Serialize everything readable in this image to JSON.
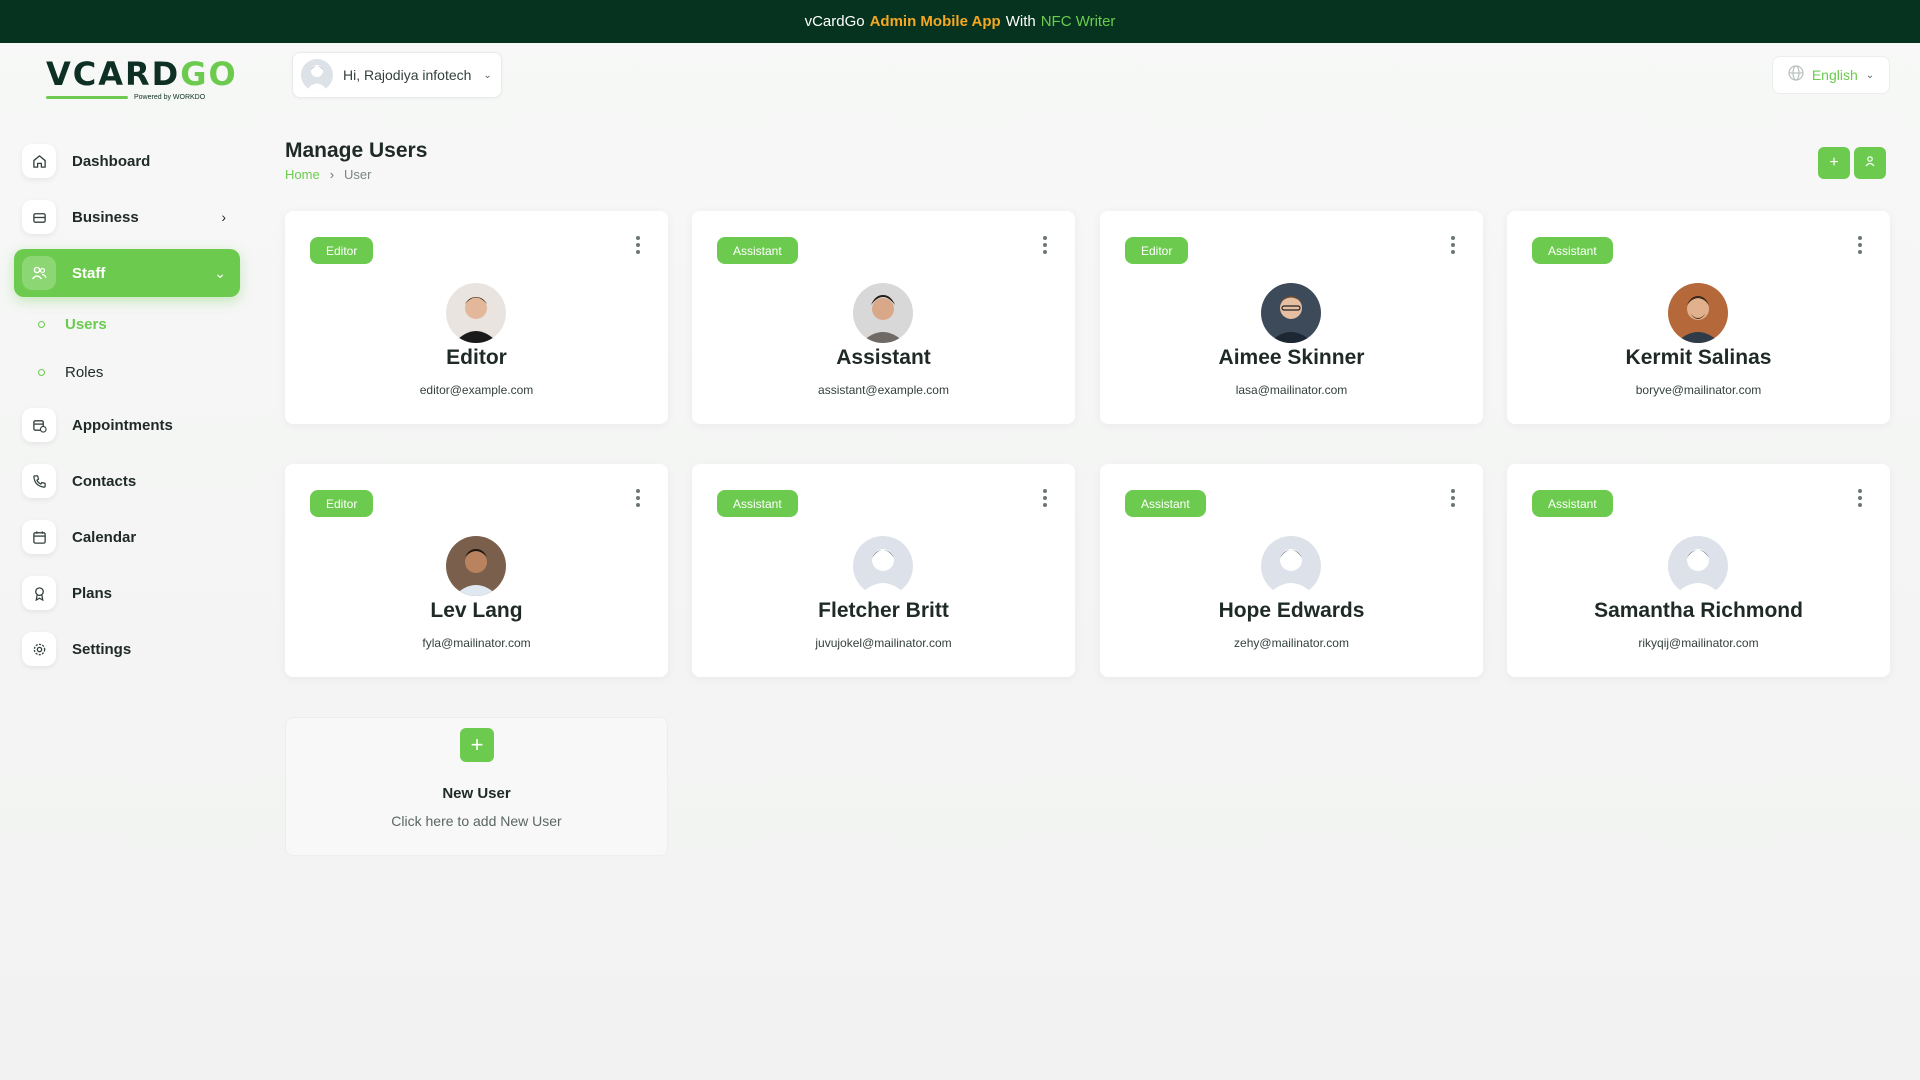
{
  "banner": {
    "part1": "vCardGo",
    "part2": "Admin Mobile App",
    "part3": "With",
    "part4": "NFC Writer"
  },
  "logo": {
    "main": "VCARD",
    "accent": "GO",
    "powered": "Powered by WORKDO"
  },
  "header": {
    "greeting": "Hi, Rajodiya infotech",
    "language": "English"
  },
  "sidebar": {
    "items": [
      {
        "label": "Dashboard",
        "icon": "home-icon"
      },
      {
        "label": "Business",
        "icon": "briefcase-icon"
      },
      {
        "label": "Staff",
        "icon": "users-icon"
      },
      {
        "label": "Appointments",
        "icon": "calendar-clock-icon"
      },
      {
        "label": "Contacts",
        "icon": "phone-icon"
      },
      {
        "label": "Calendar",
        "icon": "calendar-icon"
      },
      {
        "label": "Plans",
        "icon": "award-icon"
      },
      {
        "label": "Settings",
        "icon": "gear-icon"
      }
    ],
    "staff_sub": [
      {
        "label": "Users"
      },
      {
        "label": "Roles"
      }
    ]
  },
  "page": {
    "title": "Manage Users",
    "breadcrumb_home": "Home",
    "breadcrumb_current": "User"
  },
  "users": [
    {
      "role": "Editor",
      "name": "Editor",
      "email": "editor@example.com"
    },
    {
      "role": "Assistant",
      "name": "Assistant",
      "email": "assistant@example.com"
    },
    {
      "role": "Editor",
      "name": "Aimee Skinner",
      "email": "lasa@mailinator.com"
    },
    {
      "role": "Assistant",
      "name": "Kermit Salinas",
      "email": "boryve@mailinator.com"
    },
    {
      "role": "Editor",
      "name": "Lev Lang",
      "email": "fyla@mailinator.com"
    },
    {
      "role": "Assistant",
      "name": "Fletcher Britt",
      "email": "juvujokel@mailinator.com"
    },
    {
      "role": "Assistant",
      "name": "Hope Edwards",
      "email": "zehy@mailinator.com"
    },
    {
      "role": "Assistant",
      "name": "Samantha Richmond",
      "email": "rikyqij@mailinator.com"
    }
  ],
  "new_user": {
    "title": "New User",
    "subtitle": "Click here to add New User"
  },
  "colors": {
    "accent": "#6ccb4e",
    "banner": "#05331f",
    "orange": "#f6a823"
  }
}
